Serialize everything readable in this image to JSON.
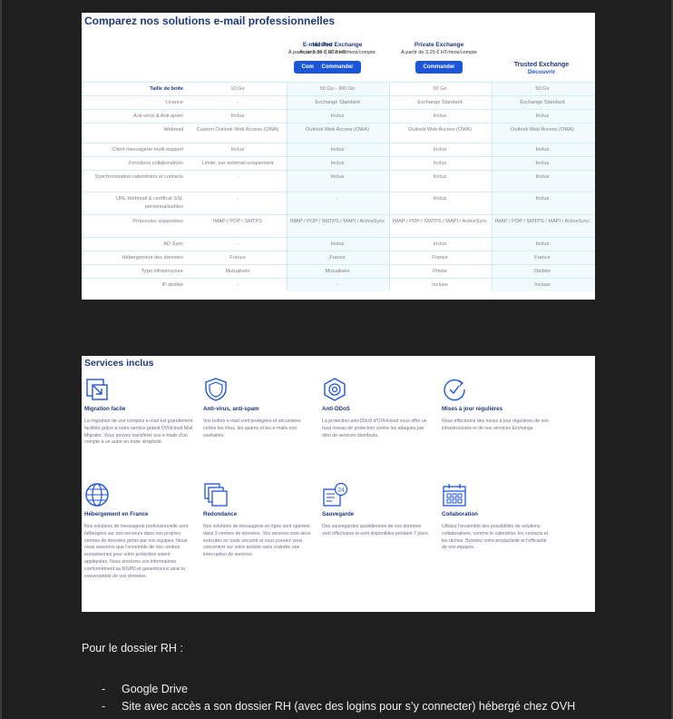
{
  "compare": {
    "title": "Comparez nos solutions e-mail professionnelles",
    "plans": [
      {
        "name": "E-mail Pro",
        "price": "À partir de 0,99 € HT/mois",
        "button": "Commander"
      },
      {
        "name": "Hosted Exchange",
        "price": "À partir de 2,99 € HT/mois/compte",
        "button": "Commander"
      },
      {
        "name": "Private Exchange",
        "price": "À partir de 3,29 € HT/mois/compte",
        "button": "Commander"
      },
      {
        "name": "Trusted Exchange",
        "link": "Découvrir"
      }
    ],
    "rows": [
      {
        "label": "Taille de boîte",
        "cells": [
          "10 Go",
          "50 Go - 300 Go",
          "50 Go",
          "50 Go"
        ]
      },
      {
        "label": "Licence",
        "cells": [
          "-",
          "Exchange Standard",
          "Exchange Standard",
          "Exchange Standard"
        ]
      },
      {
        "label": "Anti-virus & Anti-spam",
        "cells": [
          "Inclus",
          "Inclus",
          "Inclus",
          "Inclus"
        ]
      },
      {
        "label": "Webmail",
        "cells": [
          "Custom Outlook Web Access (OWA)",
          "Outlook Web Access (OWA)",
          "Outlook Web Access (OWA)",
          "Outlook Web Access (OWA)"
        ]
      },
      {
        "label": "Client messagerie multi-support",
        "cells": [
          "Inclus",
          "Inclus",
          "Inclus",
          "Inclus"
        ]
      },
      {
        "label": "Fonctions collaboratives",
        "cells": [
          "Limité, par webmail uniquement",
          "Inclus",
          "Inclus",
          "Inclus"
        ]
      },
      {
        "label": "Synchronisation calendriers et contacts",
        "cells": [
          "-",
          "Inclus",
          "Inclus",
          "Inclus"
        ]
      },
      {
        "label": "URL Webmail & certificat SSL personnalisables",
        "cells": [
          "-",
          "-",
          "Inclus",
          "Inclus"
        ]
      },
      {
        "label": "Protocoles supportées",
        "cells": [
          "IMAP / POP / SMTPS",
          "IMAP / POP / SMTPS / MAPI / ActiveSync",
          "IMAP / POP / SMTPS / MAPI / ActiveSync",
          "IMAP / POP / SMTPS / MAPI / ActiveSync"
        ]
      },
      {
        "label": "AD Sync",
        "cells": [
          "-",
          "Inclus",
          "Inclus",
          "Inclus"
        ]
      },
      {
        "label": "Hébergement des données",
        "cells": [
          "France",
          "France",
          "France",
          "France"
        ]
      },
      {
        "label": "Type infrastructure",
        "cells": [
          "Mutualisée",
          "Mutualisée",
          "Privée",
          "Dédiée"
        ]
      },
      {
        "label": "IP dédiée",
        "cells": [
          "-",
          "-",
          "Incluse",
          "Incluse"
        ]
      }
    ]
  },
  "services": {
    "title": "Services inclus",
    "items": [
      {
        "icon": "migration-icon",
        "title": "Migration facile",
        "text": "La migration de vos comptes e-mail est grandement facilitée grâce à notre service gratuit OVHcloud Mail Migrator. Vous pouvez transférer vos e-mails d'un compte à un autre en toute simplicité."
      },
      {
        "icon": "shield-icon",
        "title": "Anti-virus, anti-spam",
        "text": "Vos boîtes e-mail sont protégées et sécurisées contre les virus, les spams et les e-mails non souhaités."
      },
      {
        "icon": "anti-ddos-icon",
        "title": "Anti-DDoS",
        "text": "La protection anti-DDoS d'OVHcloud vous offre un haut niveau de protection contre les attaques par déni de services distribués."
      },
      {
        "icon": "update-check-icon",
        "title": "Mises à jour régulières",
        "text": "Nous effectuons des mises à jour régulières de nos infrastructures et de nos services Exchange."
      },
      {
        "icon": "globe-icon",
        "title": "Hébergement en France",
        "text": "Nos solutions de messagerie professionnelle sont hébergées sur nos serveurs dans nos propres centres de données gérés par nos équipes. Nous nous assurons que l'ensemble de nos centres européennes pour votre protection soient appliquées. Nous stockons vos informations conformément au RGPD et garantissons ainsi la souveraineté de vos données."
      },
      {
        "icon": "redundancy-icon",
        "title": "Redondance",
        "text": "Nos solutions de messagerie en ligne sont opérées dans 3 centres de données. Vos services sont ainsi exécutés en toute sécurité et vous pouvez vous concentrer sur votre activité sans craindre une interruption de services."
      },
      {
        "icon": "backup-24-icon",
        "title": "Sauvegarde",
        "text": "Des sauvegardes quotidiennes de vos données sont effectuées et sont disponibles pendant 7 jours."
      },
      {
        "icon": "calendar-icon",
        "title": "Collaboration",
        "text": "Utilisez l'ensemble des possibilités de solutions collaboratives, comme le calendrier, les contacts et les tâches. Boostez votre productivité et l'efficacité de vos équipes."
      }
    ]
  },
  "doc": {
    "heading": "Pour le dossier RH :",
    "bullets": [
      "Google Drive",
      "Site avec accès a son dossier RH (avec des logins pour s’y connecter) hébergé chez OVH"
    ]
  }
}
